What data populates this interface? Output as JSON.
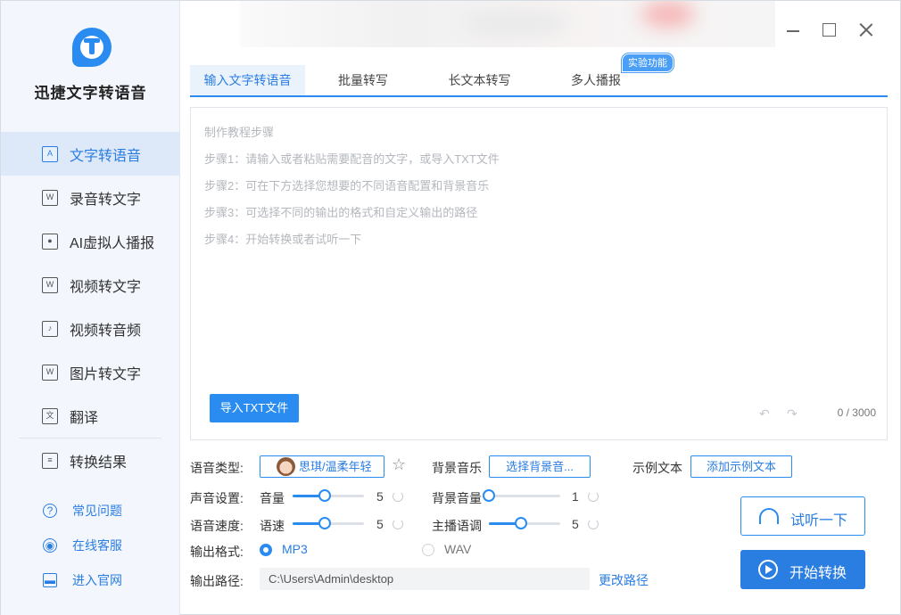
{
  "app": {
    "title": "迅捷文字转语音"
  },
  "sidebar": {
    "items": [
      {
        "label": "文字转语音",
        "icon": "text-to-speech-icon",
        "active": true
      },
      {
        "label": "录音转文字",
        "icon": "recording-to-text-icon"
      },
      {
        "label": "AI虚拟人播报",
        "icon": "ai-avatar-icon"
      },
      {
        "label": "视频转文字",
        "icon": "video-to-text-icon"
      },
      {
        "label": "视频转音频",
        "icon": "video-to-audio-icon"
      },
      {
        "label": "图片转文字",
        "icon": "image-to-text-icon"
      },
      {
        "label": "翻译",
        "icon": "translate-icon"
      },
      {
        "label": "转换结果",
        "icon": "results-icon"
      }
    ],
    "help": [
      {
        "label": "常见问题",
        "icon": "question-icon"
      },
      {
        "label": "在线客服",
        "icon": "headset-icon"
      },
      {
        "label": "进入官网",
        "icon": "monitor-icon"
      }
    ]
  },
  "tabs": [
    {
      "label": "输入文字转语音",
      "active": true
    },
    {
      "label": "批量转写"
    },
    {
      "label": "长文本转写"
    },
    {
      "label": "多人播报"
    }
  ],
  "tab_badge": "实验功能",
  "editor": {
    "placeholder_lines": [
      "制作教程步骤",
      "步骤1：请输入或者粘贴需要配音的文字，或导入TXT文件",
      "步骤2：可在下方选择您想要的不同语音配置和背景音乐",
      "步骤3：可选择不同的输出的格式和自定义输出的路径",
      "步骤4：开始转换或者试听一下"
    ],
    "import_label": "导入TXT文件",
    "counter": "0 / 3000"
  },
  "settings": {
    "voice_type_label": "语音类型:",
    "voice_value": "思琪/温柔年轻",
    "bgm_label": "背景音乐",
    "bgm_button": "选择背景音...",
    "sample_label": "示例文本",
    "sample_button": "添加示例文本",
    "sound_label": "声音设置:",
    "volume_label": "音量",
    "volume_value": "5",
    "volume_level": 0.45,
    "bgm_volume_label": "背景音量",
    "bgm_volume_value": "1",
    "bgm_volume_level": 0.0,
    "speed_label": "语音速度:",
    "rate_label": "语速",
    "rate_value": "5",
    "rate_level": 0.45,
    "pitch_label": "主播语调",
    "pitch_value": "5",
    "pitch_level": 0.45,
    "format_label": "输出格式:",
    "format_mp3": "MP3",
    "format_wav": "WAV",
    "selected_format": "MP3",
    "path_label": "输出路径:",
    "path_value": "C:\\Users\\Admin\\desktop",
    "change_path": "更改路径"
  },
  "actions": {
    "listen": "试听一下",
    "start": "开始转换"
  },
  "colors": {
    "accent": "#2a8cf0",
    "accent_dark": "#2a7de1",
    "sidebar_bg": "#f3f7fd"
  }
}
